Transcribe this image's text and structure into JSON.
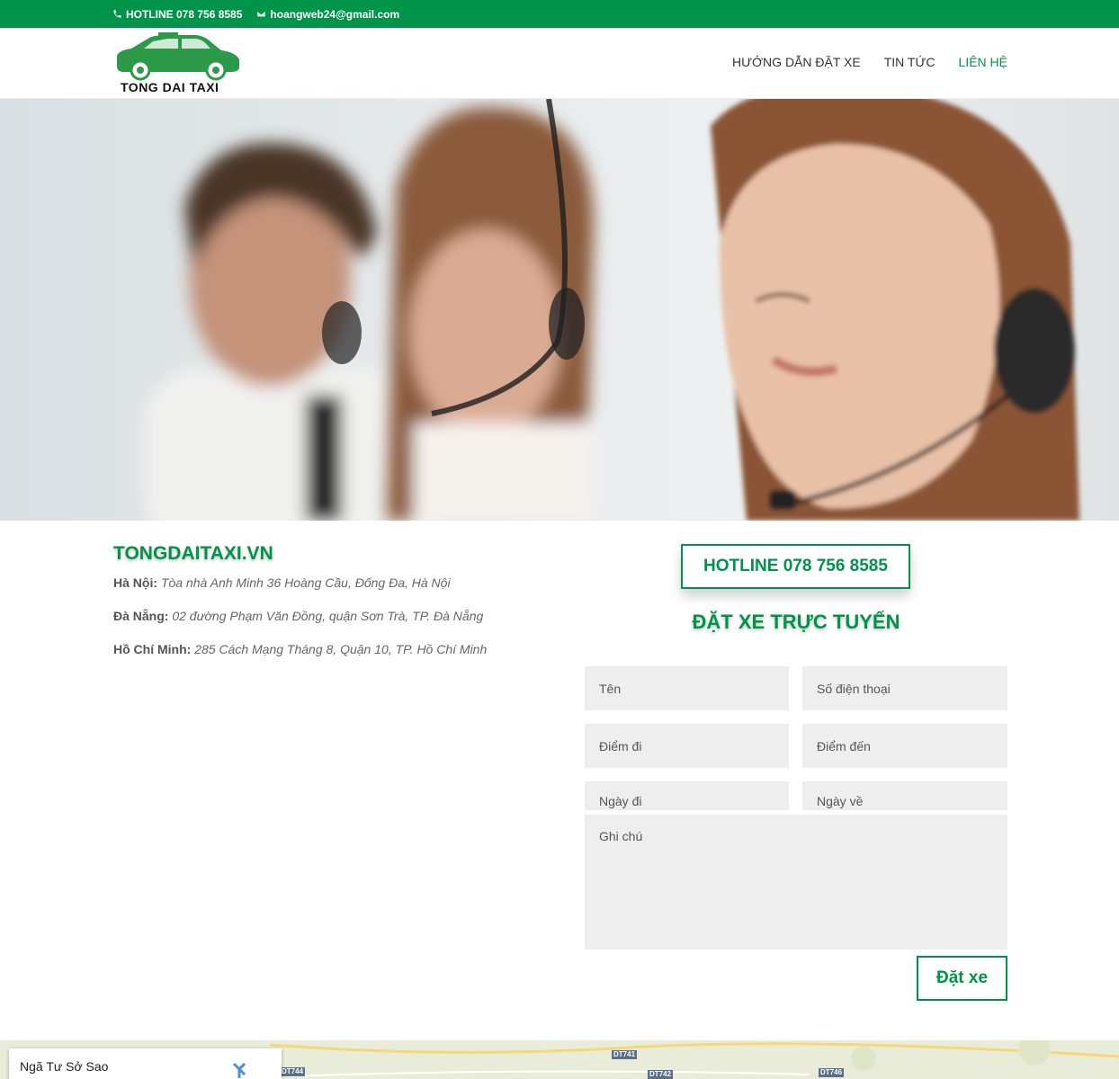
{
  "topbar": {
    "hotline": "HOTLINE 078 756 8585",
    "email": "hoangweb24@gmail.com",
    "phone_icon": "phone-icon",
    "email_icon": "email-icon",
    "bg_color": "#00944a"
  },
  "header": {
    "logo_text": "TONG DAI TAXI",
    "nav": [
      {
        "label": "HƯỚNG DẪN ĐẶT XE"
      },
      {
        "label": "TIN TỨC"
      },
      {
        "label": "LIÊN HỆ",
        "active": true
      }
    ]
  },
  "contact": {
    "brand": "TONGDAITAXI.VN",
    "addresses": [
      {
        "city": "Hà Nội:",
        "address": "Tòa nhà Anh Minh 36 Hoàng Cầu, Đống Đa, Hà Nội"
      },
      {
        "city": "Đà Nẵng:",
        "address": "02 đường Phạm Văn Đồng, quận Sơn Trà, TP. Đà Nẵng"
      },
      {
        "city": "Hồ Chí Minh:",
        "address": "285 Cách Mạng Tháng 8, Quận 10, TP. Hồ Chí Minh"
      }
    ]
  },
  "booking": {
    "hotline_button": "HOTLINE 078 756 8585",
    "title": "ĐẶT XE TRỰC TUYẾN",
    "fields": {
      "name": "Tên",
      "phone": "Số điện thoại",
      "from": "Điểm đi",
      "to": "Điểm đến",
      "depart_date": "Ngày đi",
      "return_date": "Ngày về",
      "note": "Ghi chú"
    },
    "submit": "Đặt xe",
    "accent": "#00944a"
  },
  "map": {
    "place": "Ngã Tư Sở Sao",
    "roads": [
      "DT744",
      "DT741",
      "DT742",
      "DT746"
    ]
  }
}
